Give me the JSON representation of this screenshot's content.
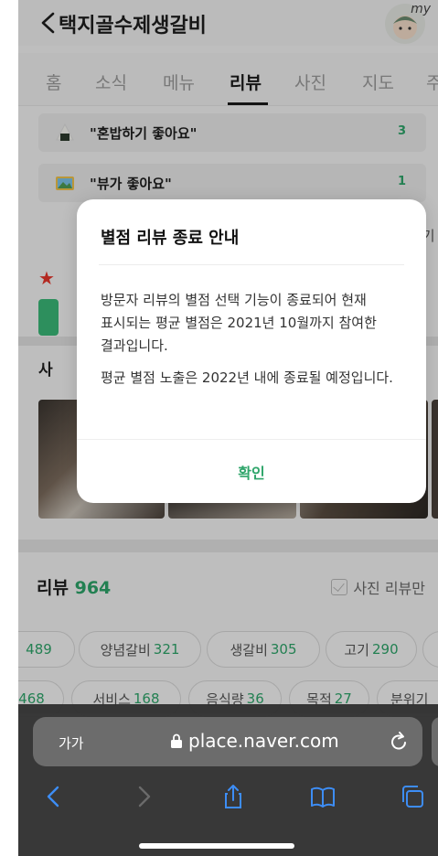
{
  "header": {
    "title": "택지골수제생갈비",
    "avatar_badge": "my"
  },
  "tabs": [
    {
      "label": "홈"
    },
    {
      "label": "소식"
    },
    {
      "label": "메뉴"
    },
    {
      "label": "리뷰",
      "active": true
    },
    {
      "label": "사진"
    },
    {
      "label": "지도"
    },
    {
      "label": "주"
    }
  ],
  "keywords": [
    {
      "emoji_icon": "rice-ball-icon",
      "label": "\"혼밥하기 좋아요\"",
      "count": "3"
    },
    {
      "emoji_icon": "landscape-picture-icon",
      "label": "\"뷰가 좋아요\"",
      "count": "1"
    }
  ],
  "peek": {
    "more_text": "접기",
    "photo_section_label": "사"
  },
  "review_section": {
    "title": "리뷰",
    "count": "964",
    "photo_only_label": "사진 리뷰만"
  },
  "chips_row1": [
    {
      "label": "",
      "count": "489"
    },
    {
      "label": "양념갈비",
      "count": "321"
    },
    {
      "label": "생갈비",
      "count": "305"
    },
    {
      "label": "고기",
      "count": "290"
    }
  ],
  "chips_row2": [
    {
      "label": "",
      "count": "468"
    },
    {
      "label": "서비스",
      "count": "168"
    },
    {
      "label": "음식량",
      "count": "36"
    },
    {
      "label": "목적",
      "count": "27"
    },
    {
      "label": "분위기",
      "count": ""
    }
  ],
  "modal": {
    "title": "별점 리뷰 종료 안내",
    "paragraph1": "방문자 리뷰의 별점 선택 기능이 종료되어 현재 표시되는 평균 별점은 2021년 10월까지 참여한 결과입니다.",
    "paragraph2": "평균 별점 노출은 2022년 내에 종료될 예정입니다.",
    "confirm_label": "확인"
  },
  "browser": {
    "text_size_label": "가가",
    "url": "place.naver.com"
  },
  "colors": {
    "accent_green": "#2ea56a",
    "star_red": "#e6352b",
    "safari_bar": "#303030"
  }
}
